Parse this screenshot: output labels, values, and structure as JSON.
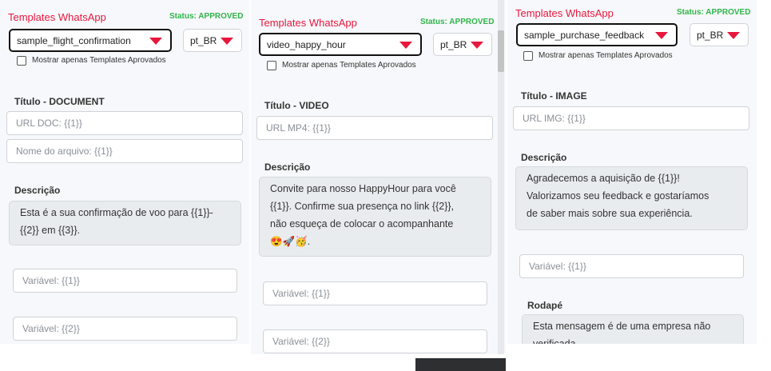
{
  "panels": [
    {
      "title": "Templates WhatsApp",
      "status": "Status: APPROVED",
      "template_select": "sample_flight_confirmation",
      "language_select": "pt_BR",
      "checkbox_label": "Mostrar apenas Templates Aprovados",
      "header_label": "Título - DOCUMENT",
      "header_fields": [
        "URL DOC: {{1}}",
        "Nome do arquivo: {{1}}"
      ],
      "description_label": "Descrição",
      "description_lines": [
        "Esta é a sua confirmação de voo para {{1}}-",
        "{{2}} em {{3}}."
      ],
      "variables": [
        "Variável: {{1}}",
        "Variável: {{2}}"
      ]
    },
    {
      "title": "Templates WhatsApp",
      "status": "Status: APPROVED",
      "template_select": "video_happy_hour",
      "language_select": "pt_BR",
      "checkbox_label": "Mostrar apenas Templates Aprovados",
      "header_label": "Título - VIDEO",
      "header_fields": [
        "URL MP4: {{1}}"
      ],
      "description_label": "Descrição",
      "description_lines": [
        "Convite para nosso HappyHour para você",
        "{{1}}. Confirme sua presença no link {{2}},",
        "não esqueça de colocar o acompanhante",
        "😍🚀🥳."
      ],
      "variables": [
        "Variável: {{1}}",
        "Variável: {{2}}"
      ]
    },
    {
      "title": "Templates WhatsApp",
      "status": "Status: APPROVED",
      "template_select": "sample_purchase_feedback",
      "language_select": "pt_BR",
      "checkbox_label": "Mostrar apenas Templates Aprovados",
      "header_label": "Título - IMAGE",
      "header_fields": [
        "URL IMG: {{1}}"
      ],
      "description_label": "Descrição",
      "description_lines": [
        "Agradecemos a aquisição de {{1}}!",
        "Valorizamos seu feedback e gostaríamos",
        "de saber mais sobre sua experiência."
      ],
      "variables": [
        "Variável: {{1}}"
      ],
      "footer_label": "Rodapé",
      "footer_lines": [
        "Esta mensagem é de uma empresa não",
        "verificada."
      ]
    }
  ]
}
